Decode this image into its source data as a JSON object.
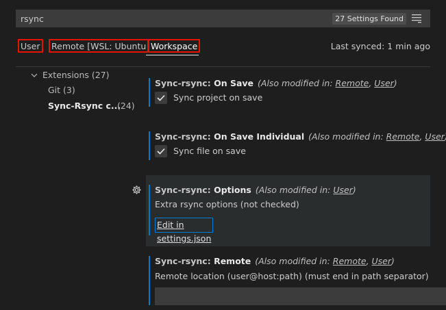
{
  "search": {
    "value": "rsync",
    "results_badge": "27 Settings Found"
  },
  "scopes": {
    "tabs": [
      {
        "label": "User"
      },
      {
        "label": "Remote [WSL: Ubuntu"
      },
      {
        "label": "Workspace"
      }
    ],
    "last_synced": "Last synced: 1 min ago"
  },
  "toc": {
    "extensions": "Extensions (27)",
    "git": "Git (3)",
    "sync_rsync": "Sync-Rsync c...",
    "sync_rsync_count": "(24)"
  },
  "settings": [
    {
      "prefix": "Sync-rsync: ",
      "name": "On Save",
      "modified_prefix": "(Also modified in: ",
      "links": [
        "Remote",
        "User"
      ],
      "sep": ", ",
      "close": ")",
      "checkbox_label": "Sync project on save",
      "checked": true
    },
    {
      "prefix": "Sync-rsync: ",
      "name": "On Save Individual",
      "modified_prefix": "(Also modified in: ",
      "links": [
        "Remote",
        "User"
      ],
      "sep": ", ",
      "close": ")",
      "checkbox_label": "Sync file on save",
      "checked": true
    },
    {
      "prefix": "Sync-rsync: ",
      "name": "Options",
      "modified_prefix": "(Also modified in: ",
      "links": [
        "User"
      ],
      "close": ")",
      "description": "Extra rsync options (not checked)",
      "edit_link": "Edit in settings.json"
    },
    {
      "prefix": "Sync-rsync: ",
      "name": "Remote",
      "modified_prefix": "(Also modified in: ",
      "links": [
        "Remote",
        "User"
      ],
      "sep": ", ",
      "close": ")",
      "description": "Remote location (user@host:path) (must end in path separator)",
      "input_value": ""
    }
  ],
  "colors": {
    "accent": "#007acc",
    "highlight_border": "#e51400",
    "background": "#1e1e1e"
  }
}
